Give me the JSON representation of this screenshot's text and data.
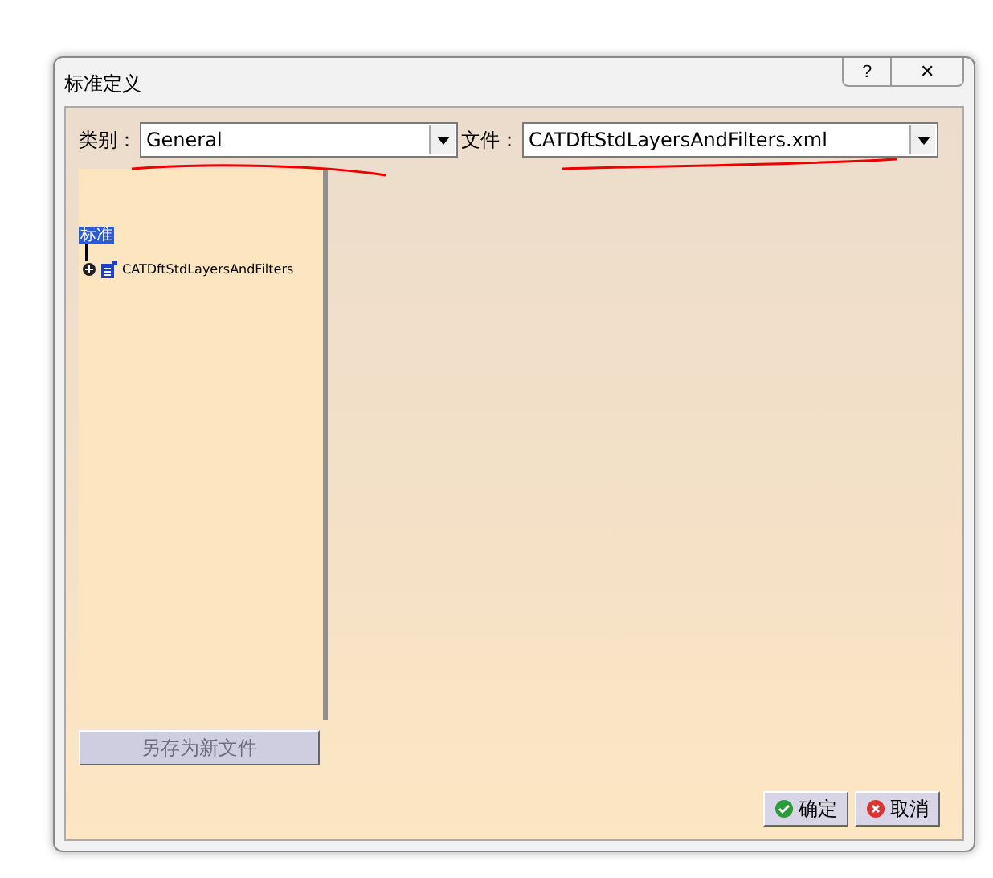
{
  "window": {
    "title": "标准定义",
    "controls": [
      "?",
      "✕"
    ]
  },
  "category": {
    "label": "类别：",
    "value": "General"
  },
  "file": {
    "label": "文件：",
    "value": "CATDftStdLayersAndFilters.xml"
  },
  "tree": [
    {
      "label": "标准",
      "selected": true,
      "expanded": true,
      "children": [
        {
          "label": "CATDftStdLayersAndFilters",
          "selected": false,
          "expanded": false
        }
      ]
    }
  ],
  "save_button": {
    "label": "另存为新文件",
    "disabled": true
  },
  "buttons": [
    {
      "label": "确定",
      "kind": "ok"
    },
    {
      "label": "取消",
      "kind": "cancel"
    }
  ]
}
